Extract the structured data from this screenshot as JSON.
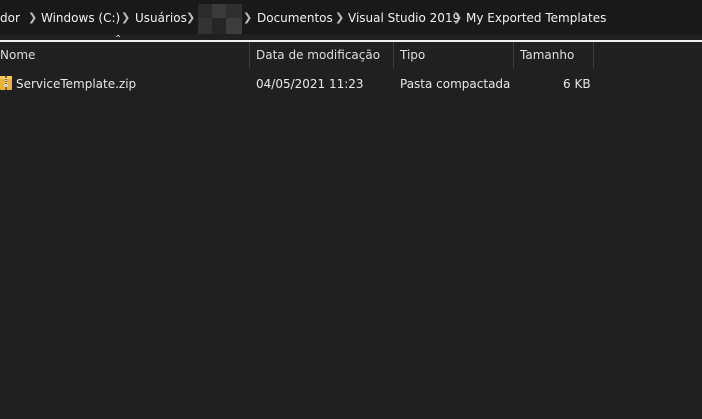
{
  "breadcrumb": {
    "items": [
      "dor",
      "Windows (C:)",
      "Usuários",
      "Documentos",
      "Visual Studio 2019",
      "My Exported Templates"
    ]
  },
  "columns": {
    "name": "Nome",
    "modified": "Data de modificação",
    "type": "Tipo",
    "size": "Tamanho"
  },
  "files": [
    {
      "name": "ServiceTemplate.zip",
      "modified": "04/05/2021 11:23",
      "type": "Pasta compactada",
      "size": "6 KB",
      "icon": "zip-folder-icon"
    }
  ]
}
